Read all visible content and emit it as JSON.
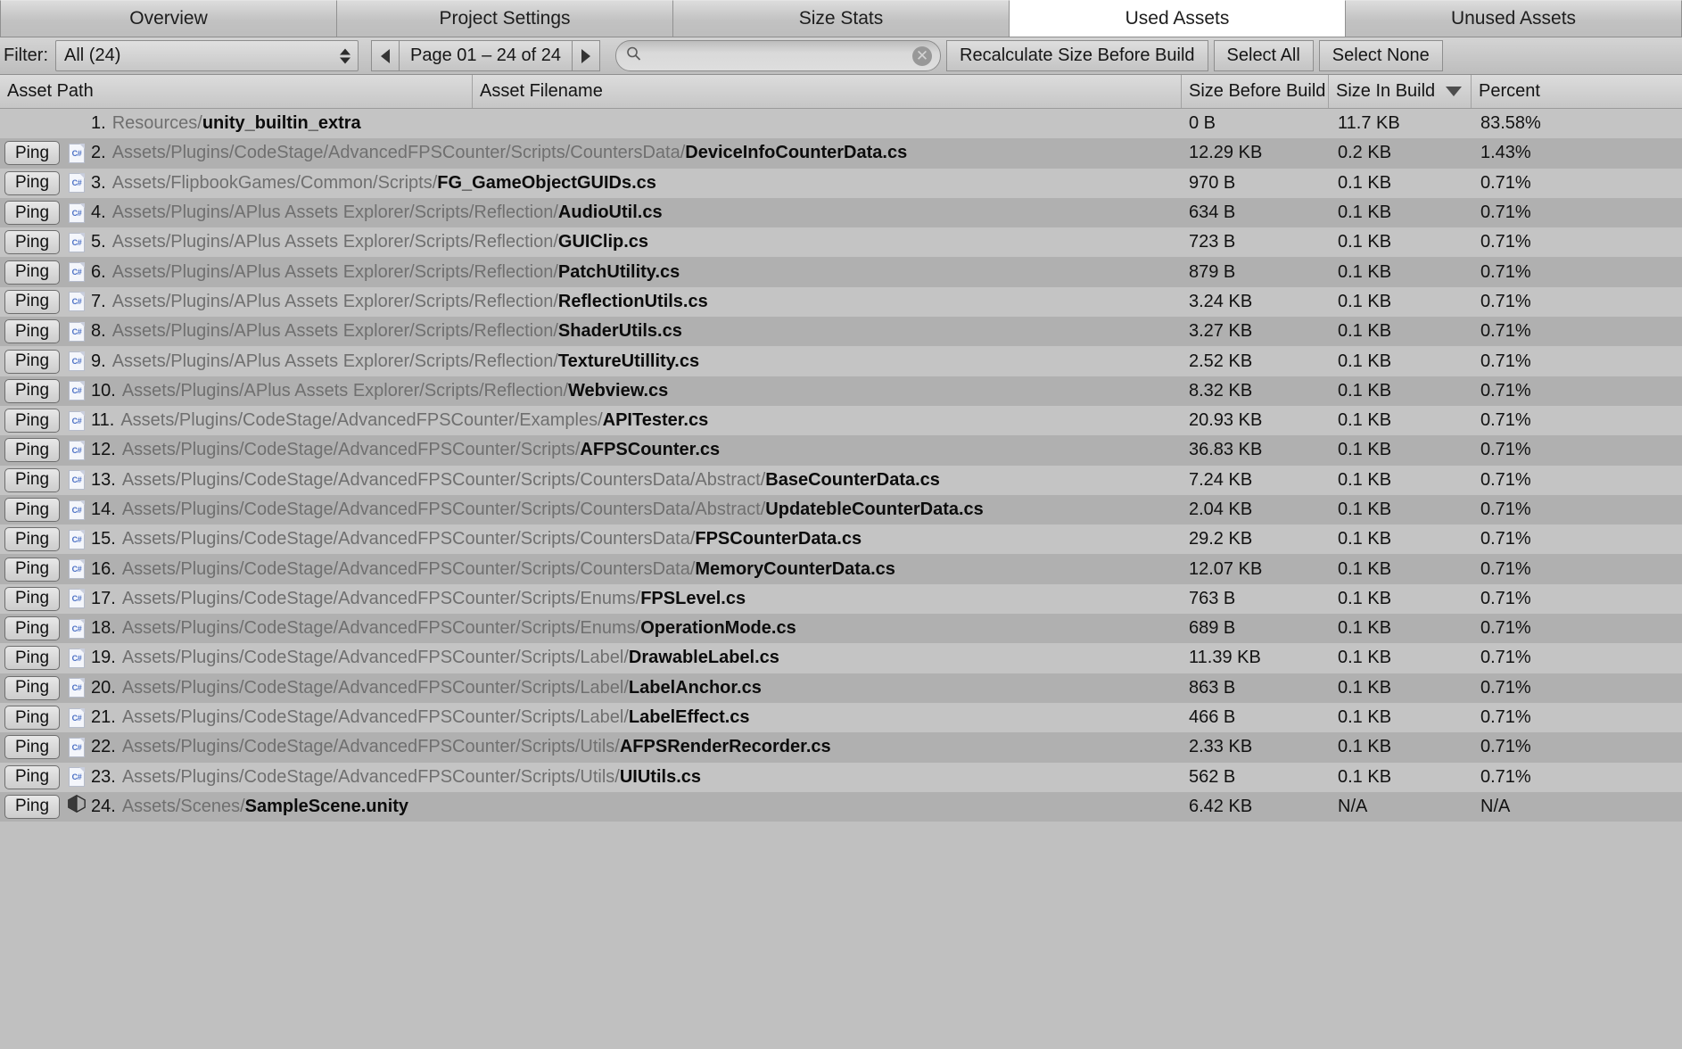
{
  "tabs": [
    {
      "label": "Overview",
      "selected": false
    },
    {
      "label": "Project Settings",
      "selected": false
    },
    {
      "label": "Size Stats",
      "selected": false
    },
    {
      "label": "Used Assets",
      "selected": true
    },
    {
      "label": "Unused Assets",
      "selected": false
    }
  ],
  "toolbar": {
    "filter_label": "Filter:",
    "filter_value": "All (24)",
    "prev_page_icon": "triangle-left-icon",
    "next_page_icon": "triangle-right-icon",
    "page_text": "Page 01 – 24 of 24",
    "search_value": "",
    "search_placeholder": "",
    "search_icon": "search-icon",
    "clear_icon": "clear-icon",
    "recalculate_label": "Recalculate Size Before Build",
    "select_all_label": "Select All",
    "select_none_label": "Select None"
  },
  "columns": {
    "asset_path": "Asset Path",
    "asset_filename": "Asset Filename",
    "size_before_build": "Size Before Build",
    "size_in_build": "Size In Build",
    "percent": "Percent",
    "sorted_column": "Size In Build",
    "sort_direction": "descending"
  },
  "ping_label": "Ping",
  "rows": [
    {
      "index": "1.",
      "ping": false,
      "icon": "none",
      "dir": "Resources/",
      "file": "unity_builtin_extra",
      "size_before": "0 B",
      "size_in": "11.7 KB",
      "percent": "83.58%"
    },
    {
      "index": "2.",
      "ping": true,
      "icon": "csharp-icon",
      "dir": "Assets/Plugins/CodeStage/AdvancedFPSCounter/Scripts/CountersData/",
      "file": "DeviceInfoCounterData.cs",
      "size_before": "12.29 KB",
      "size_in": "0.2 KB",
      "percent": "1.43%"
    },
    {
      "index": "3.",
      "ping": true,
      "icon": "csharp-icon",
      "dir": "Assets/FlipbookGames/Common/Scripts/",
      "file": "FG_GameObjectGUIDs.cs",
      "size_before": "970 B",
      "size_in": "0.1 KB",
      "percent": "0.71%"
    },
    {
      "index": "4.",
      "ping": true,
      "icon": "csharp-icon",
      "dir": "Assets/Plugins/APlus Assets Explorer/Scripts/Reflection/",
      "file": "AudioUtil.cs",
      "size_before": "634 B",
      "size_in": "0.1 KB",
      "percent": "0.71%"
    },
    {
      "index": "5.",
      "ping": true,
      "icon": "csharp-icon",
      "dir": "Assets/Plugins/APlus Assets Explorer/Scripts/Reflection/",
      "file": "GUIClip.cs",
      "size_before": "723 B",
      "size_in": "0.1 KB",
      "percent": "0.71%"
    },
    {
      "index": "6.",
      "ping": true,
      "icon": "csharp-icon",
      "dir": "Assets/Plugins/APlus Assets Explorer/Scripts/Reflection/",
      "file": "PatchUtility.cs",
      "size_before": "879 B",
      "size_in": "0.1 KB",
      "percent": "0.71%"
    },
    {
      "index": "7.",
      "ping": true,
      "icon": "csharp-icon",
      "dir": "Assets/Plugins/APlus Assets Explorer/Scripts/Reflection/",
      "file": "ReflectionUtils.cs",
      "size_before": "3.24 KB",
      "size_in": "0.1 KB",
      "percent": "0.71%"
    },
    {
      "index": "8.",
      "ping": true,
      "icon": "csharp-icon",
      "dir": "Assets/Plugins/APlus Assets Explorer/Scripts/Reflection/",
      "file": "ShaderUtils.cs",
      "size_before": "3.27 KB",
      "size_in": "0.1 KB",
      "percent": "0.71%"
    },
    {
      "index": "9.",
      "ping": true,
      "icon": "csharp-icon",
      "dir": "Assets/Plugins/APlus Assets Explorer/Scripts/Reflection/",
      "file": "TextureUtillity.cs",
      "size_before": "2.52 KB",
      "size_in": "0.1 KB",
      "percent": "0.71%"
    },
    {
      "index": "10.",
      "ping": true,
      "icon": "csharp-icon",
      "dir": "Assets/Plugins/APlus Assets Explorer/Scripts/Reflection/",
      "file": "Webview.cs",
      "size_before": "8.32 KB",
      "size_in": "0.1 KB",
      "percent": "0.71%"
    },
    {
      "index": "11.",
      "ping": true,
      "icon": "csharp-icon",
      "dir": "Assets/Plugins/CodeStage/AdvancedFPSCounter/Examples/",
      "file": "APITester.cs",
      "size_before": "20.93 KB",
      "size_in": "0.1 KB",
      "percent": "0.71%"
    },
    {
      "index": "12.",
      "ping": true,
      "icon": "csharp-icon",
      "dir": "Assets/Plugins/CodeStage/AdvancedFPSCounter/Scripts/",
      "file": "AFPSCounter.cs",
      "size_before": "36.83 KB",
      "size_in": "0.1 KB",
      "percent": "0.71%"
    },
    {
      "index": "13.",
      "ping": true,
      "icon": "csharp-icon",
      "dir": "Assets/Plugins/CodeStage/AdvancedFPSCounter/Scripts/CountersData/Abstract/",
      "file": "BaseCounterData.cs",
      "size_before": "7.24 KB",
      "size_in": "0.1 KB",
      "percent": "0.71%"
    },
    {
      "index": "14.",
      "ping": true,
      "icon": "csharp-icon",
      "dir": "Assets/Plugins/CodeStage/AdvancedFPSCounter/Scripts/CountersData/Abstract/",
      "file": "UpdatebleCounterData.cs",
      "size_before": "2.04 KB",
      "size_in": "0.1 KB",
      "percent": "0.71%"
    },
    {
      "index": "15.",
      "ping": true,
      "icon": "csharp-icon",
      "dir": "Assets/Plugins/CodeStage/AdvancedFPSCounter/Scripts/CountersData/",
      "file": "FPSCounterData.cs",
      "size_before": "29.2 KB",
      "size_in": "0.1 KB",
      "percent": "0.71%"
    },
    {
      "index": "16.",
      "ping": true,
      "icon": "csharp-icon",
      "dir": "Assets/Plugins/CodeStage/AdvancedFPSCounter/Scripts/CountersData/",
      "file": "MemoryCounterData.cs",
      "size_before": "12.07 KB",
      "size_in": "0.1 KB",
      "percent": "0.71%"
    },
    {
      "index": "17.",
      "ping": true,
      "icon": "csharp-icon",
      "dir": "Assets/Plugins/CodeStage/AdvancedFPSCounter/Scripts/Enums/",
      "file": "FPSLevel.cs",
      "size_before": "763 B",
      "size_in": "0.1 KB",
      "percent": "0.71%"
    },
    {
      "index": "18.",
      "ping": true,
      "icon": "csharp-icon",
      "dir": "Assets/Plugins/CodeStage/AdvancedFPSCounter/Scripts/Enums/",
      "file": "OperationMode.cs",
      "size_before": "689 B",
      "size_in": "0.1 KB",
      "percent": "0.71%"
    },
    {
      "index": "19.",
      "ping": true,
      "icon": "csharp-icon",
      "dir": "Assets/Plugins/CodeStage/AdvancedFPSCounter/Scripts/Label/",
      "file": "DrawableLabel.cs",
      "size_before": "11.39 KB",
      "size_in": "0.1 KB",
      "percent": "0.71%"
    },
    {
      "index": "20.",
      "ping": true,
      "icon": "csharp-icon",
      "dir": "Assets/Plugins/CodeStage/AdvancedFPSCounter/Scripts/Label/",
      "file": "LabelAnchor.cs",
      "size_before": "863 B",
      "size_in": "0.1 KB",
      "percent": "0.71%"
    },
    {
      "index": "21.",
      "ping": true,
      "icon": "csharp-icon",
      "dir": "Assets/Plugins/CodeStage/AdvancedFPSCounter/Scripts/Label/",
      "file": "LabelEffect.cs",
      "size_before": "466 B",
      "size_in": "0.1 KB",
      "percent": "0.71%"
    },
    {
      "index": "22.",
      "ping": true,
      "icon": "csharp-icon",
      "dir": "Assets/Plugins/CodeStage/AdvancedFPSCounter/Scripts/Utils/",
      "file": "AFPSRenderRecorder.cs",
      "size_before": "2.33 KB",
      "size_in": "0.1 KB",
      "percent": "0.71%"
    },
    {
      "index": "23.",
      "ping": true,
      "icon": "csharp-icon",
      "dir": "Assets/Plugins/CodeStage/AdvancedFPSCounter/Scripts/Utils/",
      "file": "UIUtils.cs",
      "size_before": "562 B",
      "size_in": "0.1 KB",
      "percent": "0.71%"
    },
    {
      "index": "24.",
      "ping": true,
      "icon": "unity-icon",
      "dir": "Assets/Scenes/",
      "file": "SampleScene.unity",
      "size_before": "6.42 KB",
      "size_in": "N/A",
      "percent": "N/A"
    }
  ]
}
